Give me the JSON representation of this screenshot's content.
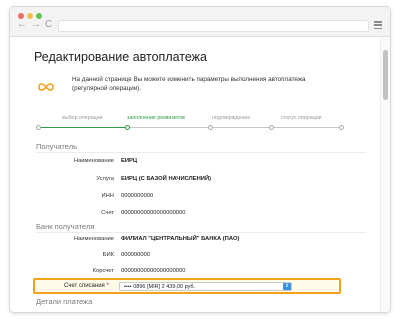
{
  "browser": {
    "back_icon": "←",
    "forward_icon": "→",
    "reload_icon": "C"
  },
  "page": {
    "title": "Редактирование автоплатежа",
    "info_text": "На данной странице Вы можете изменить параметры выполнения автоплатежа (регулярной операции)."
  },
  "steps": [
    {
      "label": "выбор операции",
      "state": "done"
    },
    {
      "label": "заполнение реквизитов",
      "state": "active"
    },
    {
      "label": "подтверждение",
      "state": "todo"
    },
    {
      "label": "статус операции",
      "state": "todo"
    }
  ],
  "recipient": {
    "section_title": "Получатель",
    "rows": [
      {
        "label": "Наименование",
        "value": "ЕИРЦ"
      },
      {
        "label": "Услуга",
        "value": "ЕИРЦ (С БАЗОЙ НАЧИСЛЕНИЙ)"
      },
      {
        "label": "ИНН",
        "value": "0000000000"
      },
      {
        "label": "Счет",
        "value": "00000000000000000000"
      }
    ]
  },
  "bank": {
    "section_title": "Банк получателя",
    "rows": [
      {
        "label": "Наименование",
        "value": "ФИЛИАЛ \"ЦЕНТРАЛЬНЫЙ\" БАНКА (ПАО)"
      },
      {
        "label": "БИК",
        "value": "000000000"
      },
      {
        "label": "Корсчет",
        "value": "00000000000000000000"
      }
    ]
  },
  "debit": {
    "label": "Счет списания",
    "required_mark": "*",
    "value": "•••• 0896   [MIR] 2 439,00   руб.",
    "arrow": "⇕"
  },
  "details": {
    "section_title": "Детали платежа"
  },
  "colors": {
    "accent_green": "#2e9d4a",
    "highlight_orange": "#f3a21b",
    "select_blue": "#3b8fe0",
    "infinity_orange": "#f0a21b"
  }
}
